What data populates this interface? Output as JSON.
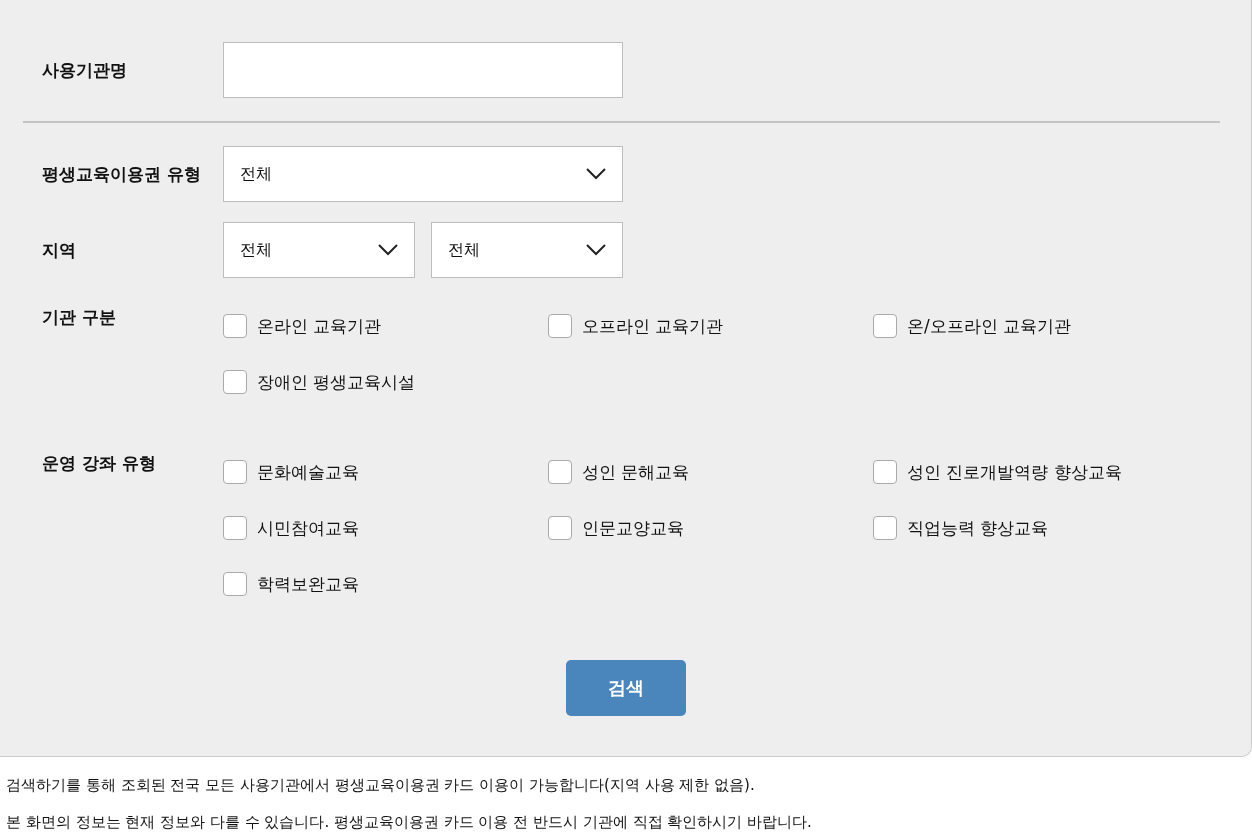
{
  "form": [
    {
      "kind": "text",
      "label": "사용기관명"
    },
    {
      "kind": "divider"
    },
    {
      "kind": "select",
      "label": "평생교육이용권 유형",
      "selects": [
        {
          "value": "전체"
        }
      ]
    },
    {
      "kind": "select",
      "label": "지역",
      "selects": [
        {
          "value": "전체"
        },
        {
          "value": "전체"
        }
      ]
    },
    {
      "kind": "checkboxes",
      "label": "기관 구분",
      "options": [
        {
          "label": "온라인 교육기관",
          "checked": false
        },
        {
          "label": "오프라인 교육기관",
          "checked": false
        },
        {
          "label": "온/오프라인 교육기관",
          "checked": false
        },
        {
          "label": "장애인 평생교육시설",
          "checked": false
        }
      ]
    },
    {
      "kind": "checkboxes",
      "label": "운영 강좌 유형",
      "options": [
        {
          "label": "문화예술교육",
          "checked": false
        },
        {
          "label": "성인 문해교육",
          "checked": false
        },
        {
          "label": "성인 진로개발역량 향상교육",
          "checked": false
        },
        {
          "label": "시민참여교육",
          "checked": false
        },
        {
          "label": "인문교양교육",
          "checked": false
        },
        {
          "label": "직업능력 향상교육",
          "checked": false
        },
        {
          "label": "학력보완교육",
          "checked": false
        }
      ]
    }
  ],
  "search_button": "검색",
  "notes": [
    "검색하기를 통해 조회된 전국 모든 사용기관에서 평생교육이용권 카드 이용이 가능합니다(지역 사용 제한 없음).",
    "본 화면의 정보는 현재 정보와 다를 수 있습니다. 평생교육이용권 카드 이용 전 반드시 기관에 직접 확인하시기 바랍니다."
  ]
}
